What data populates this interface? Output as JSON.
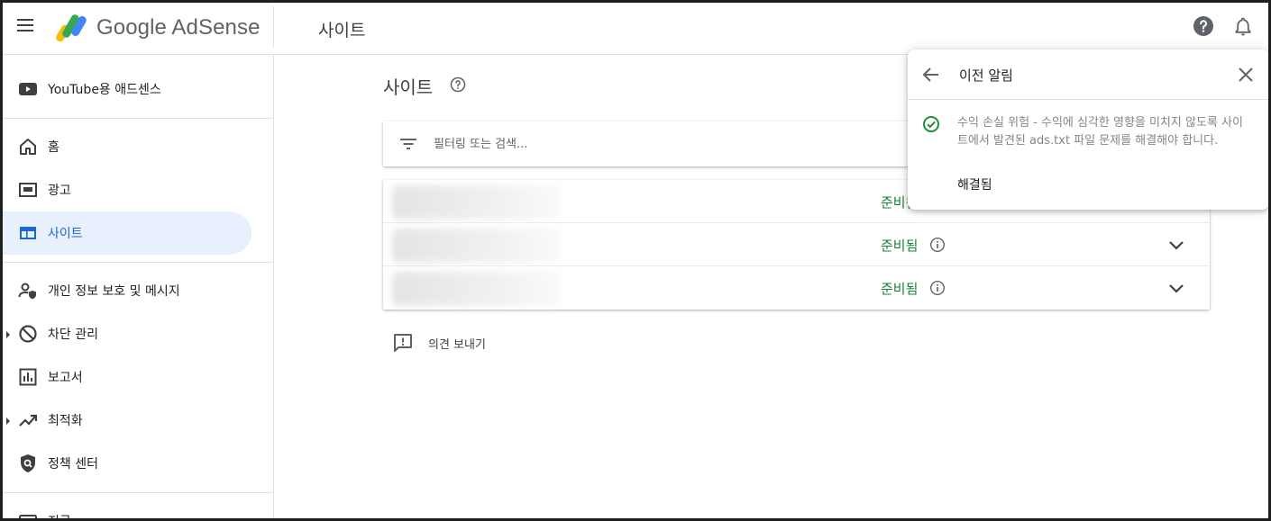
{
  "header": {
    "brand": "Google AdSense",
    "section_title": "사이트"
  },
  "sidebar": {
    "items": [
      {
        "label": "YouTube용 애드센스",
        "icon": "youtube-icon"
      },
      {
        "label": "홈",
        "icon": "home-icon"
      },
      {
        "label": "광고",
        "icon": "ads-icon"
      },
      {
        "label": "사이트",
        "icon": "web-icon"
      },
      {
        "label": "개인 정보 보호 및 메시지",
        "icon": "person-shield-icon"
      },
      {
        "label": "차단 관리",
        "icon": "block-icon"
      },
      {
        "label": "보고서",
        "icon": "reports-icon"
      },
      {
        "label": "최적화",
        "icon": "trending-up-icon"
      },
      {
        "label": "정책 센터",
        "icon": "policy-icon"
      },
      {
        "label": "지급",
        "icon": "payments-icon"
      }
    ]
  },
  "main": {
    "page_title": "사이트",
    "filter_placeholder": "필터링 또는 검색...",
    "rows": [
      {
        "status": "준비됨"
      },
      {
        "status": "준비됨"
      },
      {
        "status": "준비됨"
      }
    ],
    "feedback_label": "의견 보내기"
  },
  "notification": {
    "title": "이전 알림",
    "message": "수익 손실 위험 - 수익에 심각한 영향을 미치지 않도록 사이트에서 발견된 ads.txt 파일 문제를 해결해야 합니다.",
    "status": "해결됨"
  },
  "colors": {
    "accent": "#1967d2",
    "active_bg": "#e8f0fe",
    "status_green": "#188038",
    "check_green": "#1e8e3e"
  }
}
